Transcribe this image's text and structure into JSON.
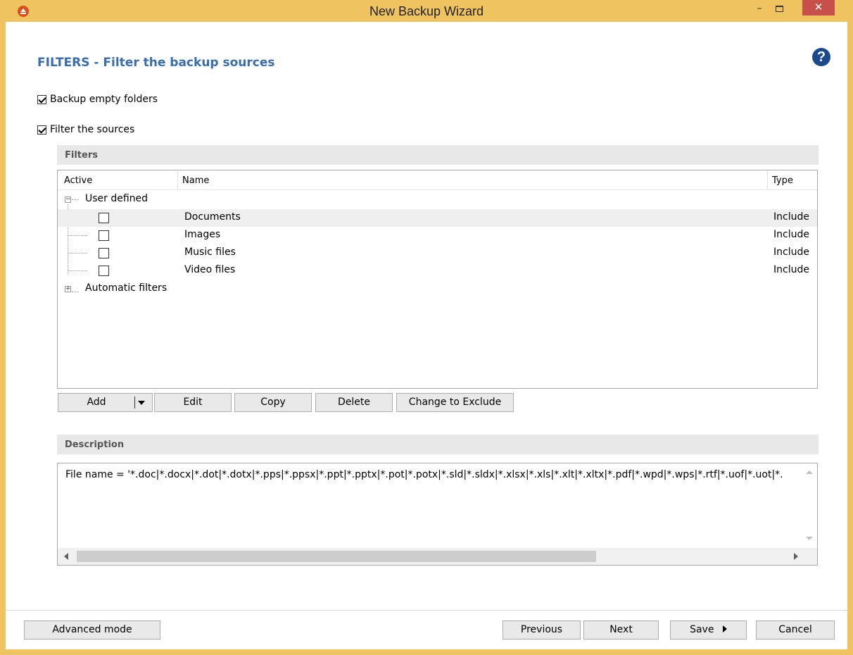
{
  "window": {
    "title": "New Backup Wizard",
    "min_glyph": "–",
    "close_glyph": "✕"
  },
  "page": {
    "heading": "FILTERS - Filter the backup sources",
    "help_glyph": "?",
    "backup_empty_folders": {
      "label": "Backup empty folders",
      "checked": true
    },
    "filter_sources": {
      "label": "Filter the sources",
      "checked": true
    }
  },
  "filters": {
    "section_title": "Filters",
    "columns": [
      "Active",
      "Name",
      "Type"
    ],
    "groups": [
      {
        "label": "User defined",
        "expanded": true,
        "items": [
          {
            "name": "Documents",
            "type": "Include",
            "active": false,
            "selected": true
          },
          {
            "name": "Images",
            "type": "Include",
            "active": false,
            "selected": false
          },
          {
            "name": "Music files",
            "type": "Include",
            "active": false,
            "selected": false
          },
          {
            "name": "Video files",
            "type": "Include",
            "active": false,
            "selected": false
          }
        ]
      },
      {
        "label": "Automatic filters",
        "expanded": false,
        "items": []
      }
    ]
  },
  "toolbar": {
    "add": "Add",
    "edit": "Edit",
    "copy": "Copy",
    "delete": "Delete",
    "change": "Change to Exclude"
  },
  "description": {
    "section_title": "Description",
    "text": "File name = '*.doc|*.docx|*.dot|*.dotx|*.pps|*.ppsx|*.ppt|*.pptx|*.pot|*.potx|*.sld|*.sldx|*.xlsx|*.xls|*.xlt|*.xltx|*.pdf|*.wpd|*.wps|*.rtf|*.uof|*.uot|*."
  },
  "footer": {
    "advanced": "Advanced mode",
    "previous": "Previous",
    "next": "Next",
    "save": "Save",
    "cancel": "Cancel"
  },
  "colors": {
    "title_bar": "#f0c361",
    "heading": "#3a6eab",
    "close_button": "#c7504b",
    "help_icon": "#1b4a8c"
  }
}
